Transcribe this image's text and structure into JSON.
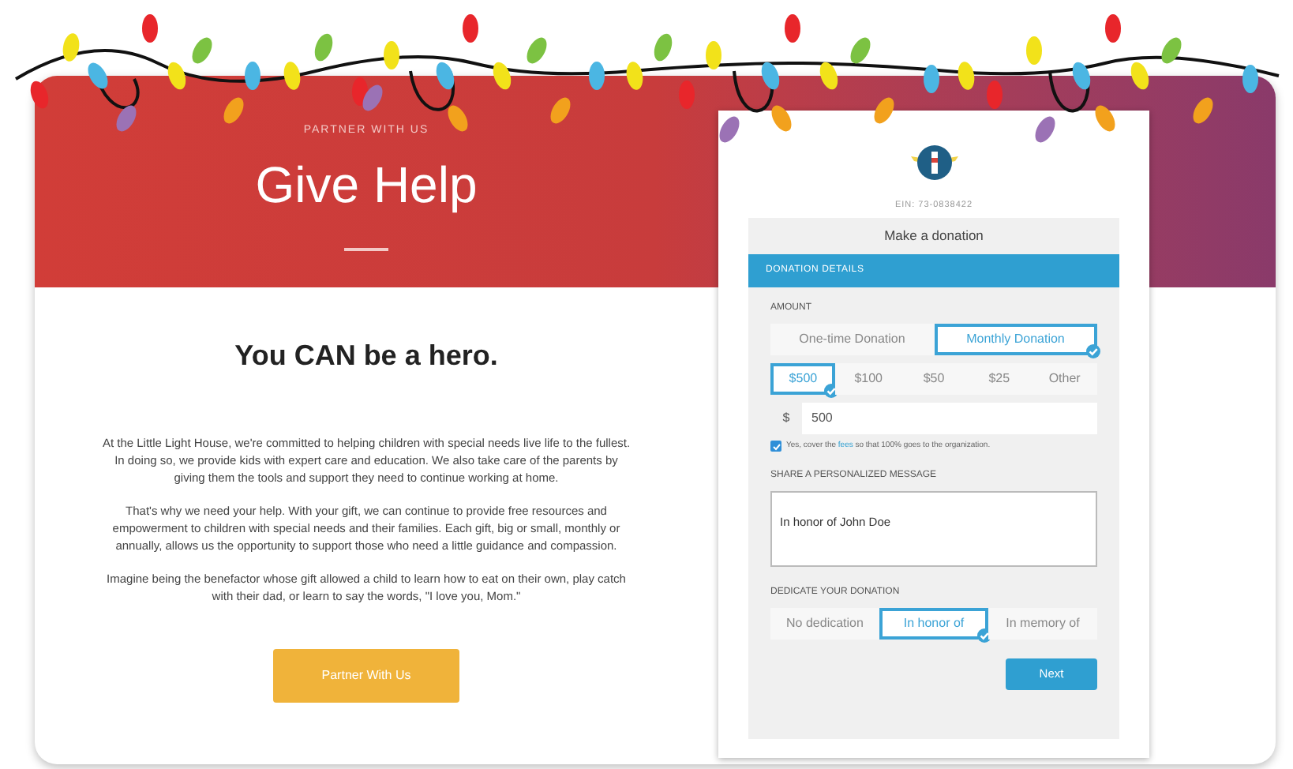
{
  "hero": {
    "eyebrow": "PARTNER WITH US",
    "title": "Give Help"
  },
  "intro": {
    "heading": "You CAN be a hero.",
    "paragraphs": [
      "At the Little Light House, we're committed to helping children with special needs live life to the fullest. In doing so, we provide kids with expert care and education. We also take care of the parents by giving them the tools and support they need to continue working at home.",
      "That's why we need your help. With your gift, we can continue to provide free resources and empowerment to children with special needs and their families. Each gift, big or small, monthly or annually, allows us the opportunity to support those who need a little guidance and compassion.",
      "Imagine being the benefactor whose gift allowed a child to learn how to eat on their own, play catch with their dad, or learn to say the words, \"I love you, Mom.\""
    ],
    "button": "Partner With Us"
  },
  "form": {
    "ein": "EIN: 73-0838422",
    "title": "Make a donation",
    "section": "DONATION DETAILS",
    "amount_label": "AMOUNT",
    "frequency": [
      {
        "label": "One-time Donation",
        "selected": false
      },
      {
        "label": "Monthly Donation",
        "selected": true
      }
    ],
    "amounts": [
      {
        "label": "$500",
        "selected": true
      },
      {
        "label": "$100",
        "selected": false
      },
      {
        "label": "$50",
        "selected": false
      },
      {
        "label": "$25",
        "selected": false
      },
      {
        "label": "Other",
        "selected": false
      }
    ],
    "currency": "$",
    "amount_value": "500",
    "cover_fees": {
      "checked": true,
      "before": "Yes, cover the",
      "link": "fees",
      "after": "so that 100% goes to the organization."
    },
    "message_label": "SHARE A PERSONALIZED MESSAGE",
    "message": "In honor of John Doe",
    "dedicate_label": "DEDICATE YOUR DONATION",
    "dedications": [
      {
        "label": "No dedication",
        "selected": false
      },
      {
        "label": "In honor of",
        "selected": true
      },
      {
        "label": "In memory of",
        "selected": false
      }
    ],
    "next": "Next"
  }
}
